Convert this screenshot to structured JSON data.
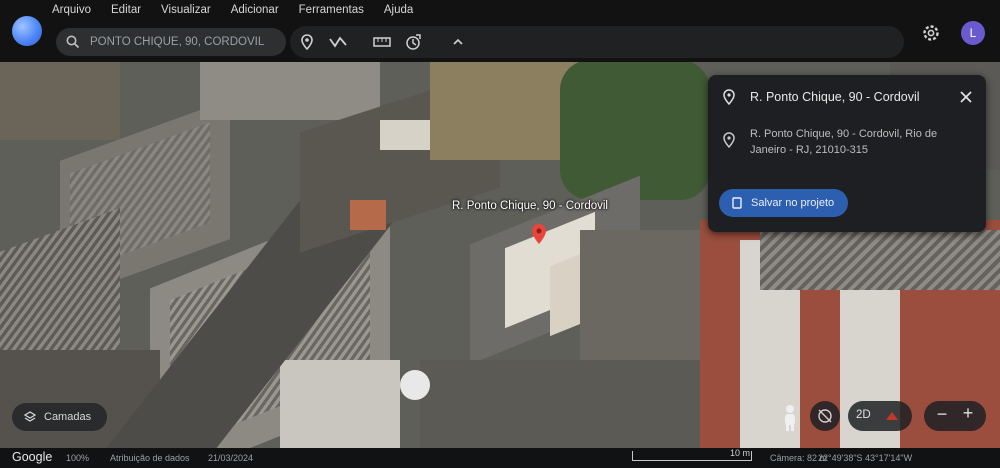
{
  "menu": [
    "Arquivo",
    "Editar",
    "Visualizar",
    "Adicionar",
    "Ferramentas",
    "Ajuda"
  ],
  "search": {
    "value": "PONTO CHIQUE, 90, CORDOVIL"
  },
  "account": {
    "initial": "L"
  },
  "panel": {
    "title": "R. Ponto Chique, 90 - Cordovil",
    "address": "R. Ponto Chique, 90 - Cordovil, Rio de Janeiro - RJ, 21010-315",
    "save_label": "Salvar no projeto"
  },
  "map": {
    "label": "R. Ponto Chique, 90 - Cordovil"
  },
  "controls": {
    "layers_label": "Camadas",
    "mode_2d": "2D",
    "zoom_out": "−",
    "zoom_in": "+"
  },
  "footer": {
    "logo": "Google",
    "zoom_pct": "100%",
    "credit": "Atribuição de dados",
    "date": "21/03/2024",
    "scale": "10 m",
    "camera": "Câmera: 82 m",
    "coords": "22°49'38\"S 43°17'14\"W"
  },
  "colors": {
    "accent": "#2d5fb0",
    "topbar": "#121212",
    "panel": "#1e1f22"
  }
}
